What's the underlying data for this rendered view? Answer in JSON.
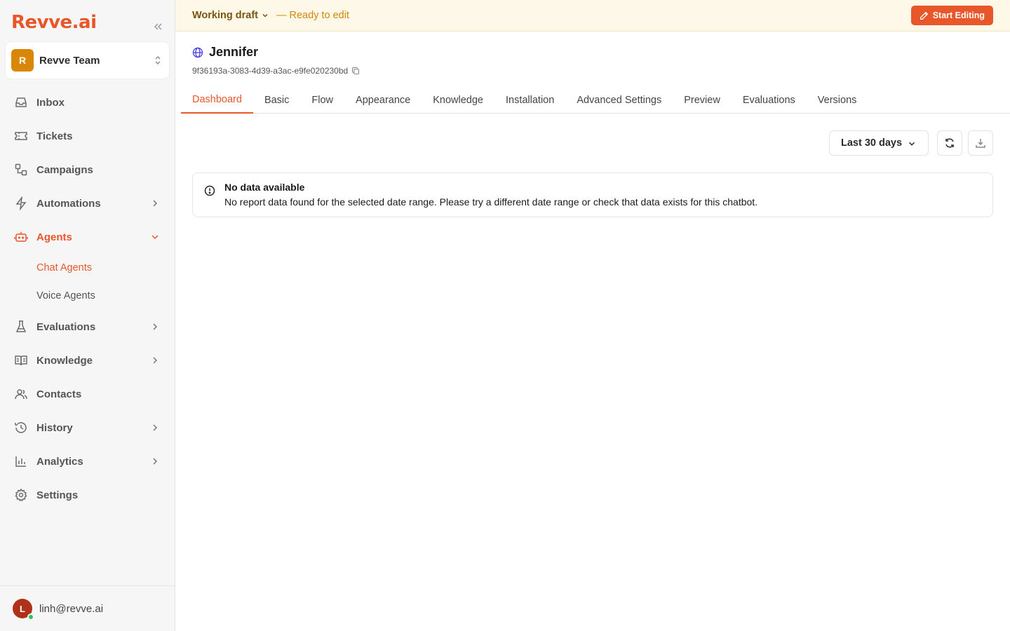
{
  "brand": {
    "logo": "Revve.ai",
    "accent_color": "#e8572a"
  },
  "team": {
    "initial": "R",
    "name": "Revve Team"
  },
  "sidebar": {
    "items": [
      {
        "label": "Inbox",
        "icon": "inbox-icon"
      },
      {
        "label": "Tickets",
        "icon": "ticket-icon"
      },
      {
        "label": "Campaigns",
        "icon": "campaigns-icon"
      },
      {
        "label": "Automations",
        "icon": "lightning-icon",
        "expandable": true
      },
      {
        "label": "Agents",
        "icon": "bot-icon",
        "expandable": true,
        "expanded": true,
        "active": true
      },
      {
        "label": "Evaluations",
        "icon": "flask-icon",
        "expandable": true
      },
      {
        "label": "Knowledge",
        "icon": "book-icon",
        "expandable": true
      },
      {
        "label": "Contacts",
        "icon": "users-icon"
      },
      {
        "label": "History",
        "icon": "history-icon",
        "expandable": true
      },
      {
        "label": "Analytics",
        "icon": "bar-chart-icon",
        "expandable": true
      },
      {
        "label": "Settings",
        "icon": "gear-icon"
      }
    ],
    "agents_sub": [
      {
        "label": "Chat Agents",
        "active": true
      },
      {
        "label": "Voice Agents"
      }
    ]
  },
  "user": {
    "initial": "L",
    "email": "linh@revve.ai",
    "status": "online"
  },
  "draft_bar": {
    "label": "Working draft",
    "status": "— Ready to edit",
    "button": "Start Editing"
  },
  "agent": {
    "name": "Jennifer",
    "id": "9f36193a-3083-4d39-a3ac-e9fe020230bd"
  },
  "tabs": [
    {
      "label": "Dashboard",
      "active": true
    },
    {
      "label": "Basic"
    },
    {
      "label": "Flow"
    },
    {
      "label": "Appearance"
    },
    {
      "label": "Knowledge"
    },
    {
      "label": "Installation"
    },
    {
      "label": "Advanced Settings"
    },
    {
      "label": "Preview"
    },
    {
      "label": "Evaluations"
    },
    {
      "label": "Versions"
    }
  ],
  "toolbar": {
    "range": "Last 30 days"
  },
  "alert": {
    "title": "No data available",
    "message": "No report data found for the selected date range. Please try a different date range or check that data exists for this chatbot."
  }
}
